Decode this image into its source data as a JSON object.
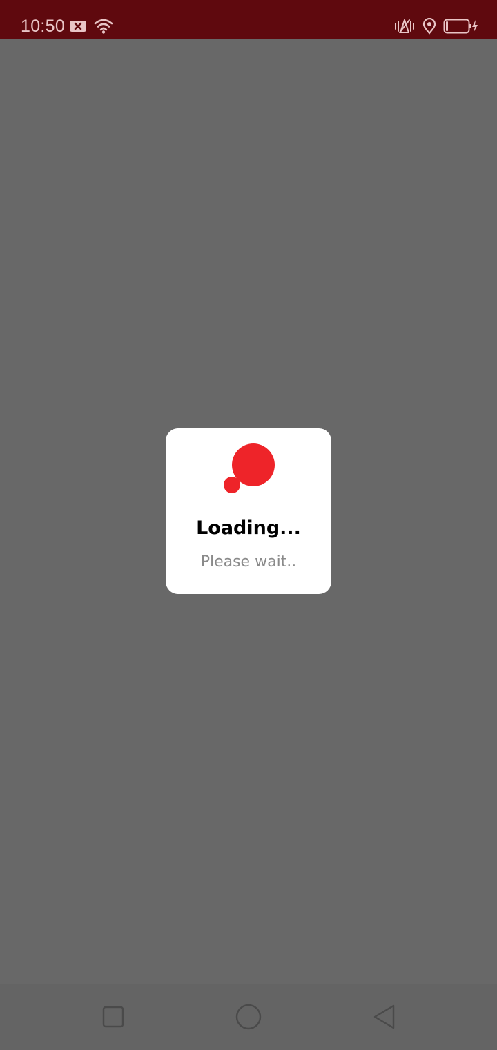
{
  "status_bar": {
    "time": "10:50",
    "background": "#5f090e",
    "icons": [
      "notification-dismissed-icon",
      "wifi-icon",
      "vibrate-icon",
      "location-icon",
      "battery-charging-icon"
    ]
  },
  "dialog": {
    "title": "Loading...",
    "subtitle": "Please wait..",
    "logo_color": "#ee2429"
  },
  "nav_bar": {
    "buttons": [
      "recent-apps-button",
      "home-button",
      "back-button"
    ]
  }
}
